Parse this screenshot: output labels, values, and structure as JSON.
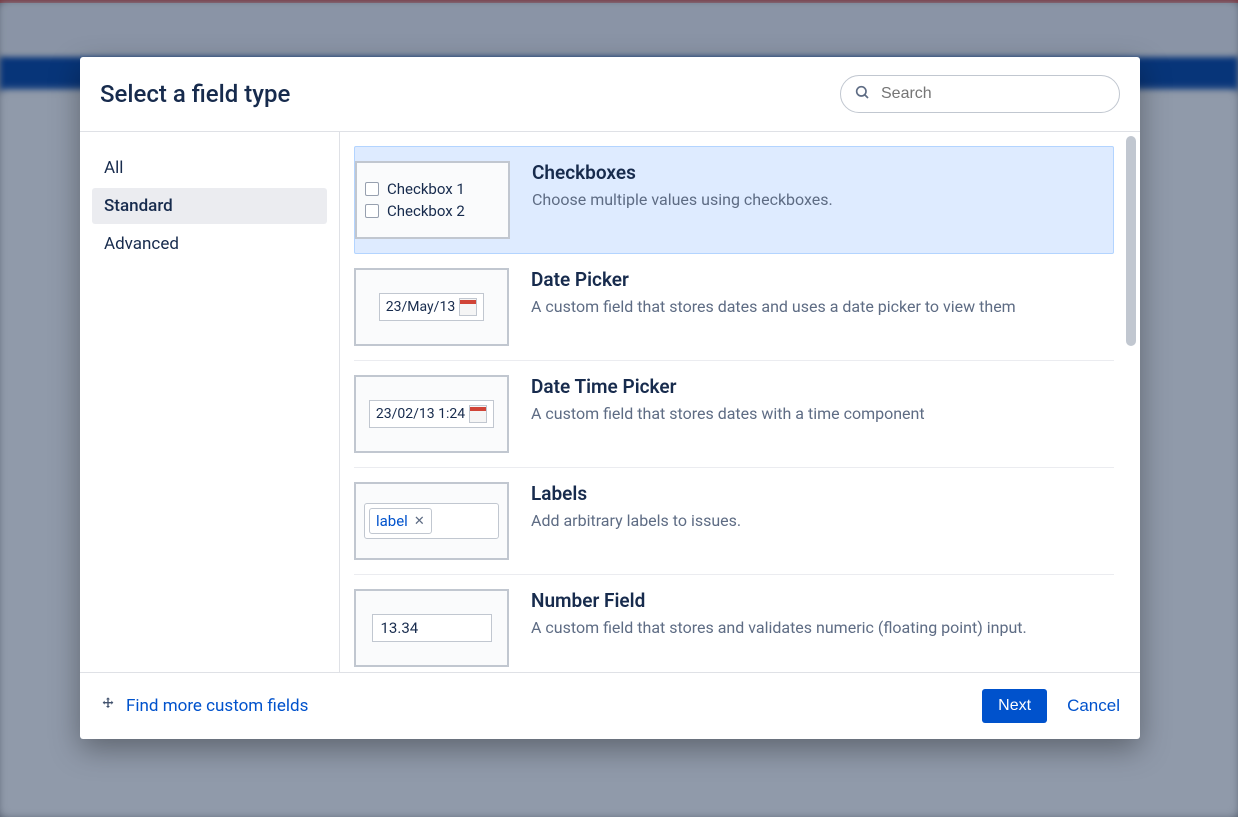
{
  "modal": {
    "title": "Select a field type",
    "search_placeholder": "Search"
  },
  "sidebar": {
    "items": [
      {
        "label": "All",
        "selected": false
      },
      {
        "label": "Standard",
        "selected": true
      },
      {
        "label": "Advanced",
        "selected": false
      }
    ]
  },
  "fields": [
    {
      "title": "Checkboxes",
      "description": "Choose multiple values using checkboxes.",
      "selected": true,
      "thumb": {
        "type": "checkboxes",
        "rows": [
          "Checkbox 1",
          "Checkbox 2"
        ]
      }
    },
    {
      "title": "Date Picker",
      "description": "A custom field that stores dates and uses a date picker to view them",
      "selected": false,
      "thumb": {
        "type": "date",
        "value": "23/May/13"
      }
    },
    {
      "title": "Date Time Picker",
      "description": "A custom field that stores dates with a time component",
      "selected": false,
      "thumb": {
        "type": "datetime",
        "value": "23/02/13 1:24"
      }
    },
    {
      "title": "Labels",
      "description": "Add arbitrary labels to issues.",
      "selected": false,
      "thumb": {
        "type": "label",
        "value": "label"
      }
    },
    {
      "title": "Number Field",
      "description": "A custom field that stores and validates numeric (floating point) input.",
      "selected": false,
      "thumb": {
        "type": "number",
        "value": "13.34"
      }
    }
  ],
  "footer": {
    "find_more": "Find more custom fields",
    "next": "Next",
    "cancel": "Cancel"
  }
}
